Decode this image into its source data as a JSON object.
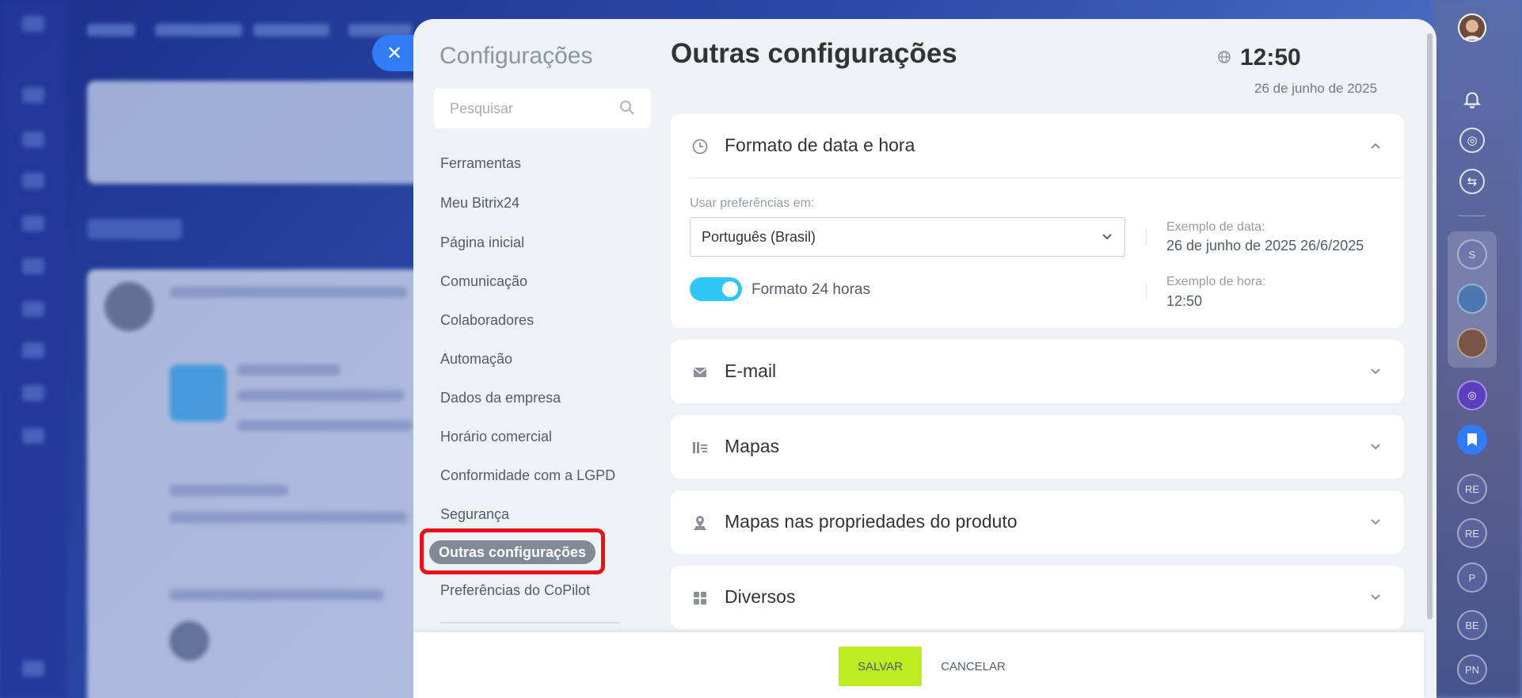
{
  "panel": {
    "sidebar_title": "Configurações",
    "search": {
      "placeholder": "Pesquisar"
    },
    "nav_items": [
      "Ferramentas",
      "Meu Bitrix24",
      "Página inicial",
      "Comunicação",
      "Colaboradores",
      "Automação",
      "Dados da empresa",
      "Horário comercial",
      "Conformidade com a LGPD",
      "Segurança",
      "Outras configurações",
      "Preferências do CoPilot"
    ],
    "active_item": "Outras configurações",
    "main_title": "Outras configurações",
    "clock": {
      "time": "12:50",
      "date": "26 de junho de 2025"
    }
  },
  "date_format": {
    "title": "Formato de data e hora",
    "use_prefs_label": "Usar preferências em:",
    "language_value": "Português (Brasil)",
    "date_example_label": "Exemplo de data:",
    "date_example_value": "26 de junho de 2025 26/6/2025",
    "time_example_label": "Exemplo de hora:",
    "time_example_value": "12:50",
    "format_24h_label": "Formato 24 horas",
    "format_24h_on": true
  },
  "sections": [
    {
      "title": "E-mail",
      "icon": "envelope-icon"
    },
    {
      "title": "Mapas",
      "icon": "map-icon"
    },
    {
      "title": "Mapas nas propriedades do produto",
      "icon": "location-pin-icon"
    },
    {
      "title": "Diversos",
      "icon": "grid-icon"
    }
  ],
  "footer": {
    "save_label": "SALVAR",
    "cancel_label": "CANCELAR"
  },
  "right_rail": {
    "avatars": [
      "S",
      "RE",
      "RE",
      "P",
      "BE",
      "PN"
    ]
  },
  "colors": {
    "accent_save": "#bbed21",
    "toggle_on": "#2fc6f6",
    "highlight": "#e8121b",
    "close_button": "#2f7cf6"
  }
}
